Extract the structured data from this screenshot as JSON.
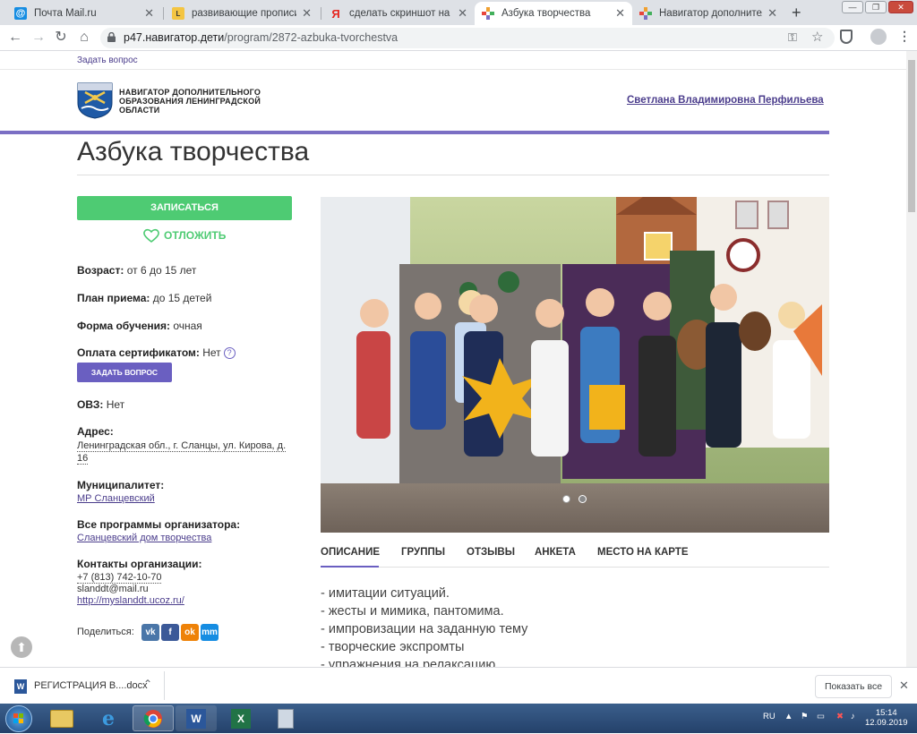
{
  "browser": {
    "tabs": [
      {
        "title": "Почта Mail.ru",
        "icon": "mail-ru-icon"
      },
      {
        "title": "развивающие прописи. Обс",
        "icon": "ls-icon"
      },
      {
        "title": "сделать скриншот на компь",
        "icon": "yandex-icon"
      },
      {
        "title": "Азбука творчества",
        "icon": "navigator-icon"
      },
      {
        "title": "Навигатор дополнительного",
        "icon": "navigator-icon"
      }
    ],
    "new_tab": "+",
    "url_host": "p47.навигатор.дети",
    "url_path": "/program/2872-azbuka-tvorchestva"
  },
  "site": {
    "ask_question_top": "Задать вопрос",
    "logo_line1": "НАВИГАТОР ДОПОЛНИТЕЛЬНОГО",
    "logo_line2": "ОБРАЗОВАНИЯ ЛЕНИНГРАДСКОЙ",
    "logo_line3": "ОБЛАСТИ",
    "user_name": "Светлана Владимировна Перфильева"
  },
  "program": {
    "title": "Азбука творчества",
    "enroll_button": "ЗАПИСАТЬСЯ",
    "postpone_button": "ОТЛОЖИТЬ",
    "age_label": "Возраст:",
    "age_value": "от 6 до 15 лет",
    "plan_label": "План приема:",
    "plan_value": "до 15 детей",
    "form_label": "Форма обучения:",
    "form_value": "очная",
    "payment_label": "Оплата сертификатом:",
    "payment_value": "Нет",
    "help_mark": "?",
    "ask_button": "ЗАДАТЬ ВОПРОС",
    "ovz_label": "ОВЗ:",
    "ovz_value": "Нет",
    "address_label": "Адрес:",
    "address_line1": "Ленинградская обл., г. Сланцы, ул. Кирова, д.",
    "address_line2": "16",
    "municipality_label": "Муниципалитет:",
    "municipality_value": "МР Сланцевский",
    "all_programs_label": "Все программы организатора:",
    "all_programs_value": "Сланцевский дом творчества",
    "contacts_label": "Контакты организации:",
    "phone": "+7 (813) 742-10-70",
    "email": "slanddt@mail.ru",
    "website": "http://myslanddt.ucoz.ru/",
    "share_label": "Поделиться:",
    "share_buttons": [
      "vk",
      "f",
      "ok",
      "mm"
    ]
  },
  "tabs": [
    "ОПИСАНИЕ",
    "ГРУППЫ",
    "ОТЗЫВЫ",
    "АНКЕТА",
    "МЕСТО НА КАРТЕ"
  ],
  "description_lines": [
    "- имитации ситуаций.",
    "- жесты и мимика, пантомима.",
    "- импровизации на заданную тему",
    "- творческие экспромты",
    "- упражнения на релаксацию"
  ],
  "slider": {
    "slides": 2,
    "active": 1
  },
  "downloads": {
    "file_name": "РЕГИСТРАЦИЯ В....docx",
    "show_all": "Показать все"
  },
  "taskbar": {
    "lang": "RU",
    "time": "15:14",
    "date": "12.09.2019"
  },
  "colors": {
    "accent_purple": "#6a5fc1",
    "enroll_green": "#4ecb73",
    "link": "#4b3d8c"
  }
}
